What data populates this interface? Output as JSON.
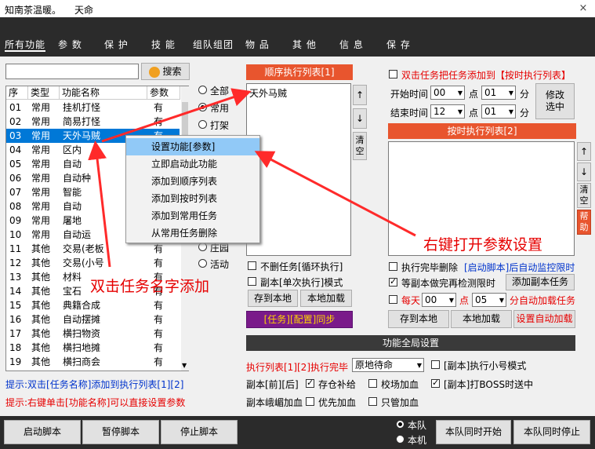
{
  "window": {
    "title": "知南茶温暖。",
    "subtitle": "天命",
    "close": "×"
  },
  "menu": [
    "所有功能",
    "参 数",
    "保 护",
    "技 能",
    "组队组团",
    "物 品",
    "其 他",
    "信 息",
    "保 存"
  ],
  "search": {
    "value": "",
    "button": "搜索"
  },
  "table": {
    "headers": [
      "序",
      "类型",
      "功能名称",
      "参数"
    ],
    "rows": [
      [
        "01",
        "常用",
        "挂机打怪",
        "有"
      ],
      [
        "02",
        "常用",
        "简易打怪",
        "有"
      ],
      [
        "03",
        "常用",
        "天外马贼",
        "有"
      ],
      [
        "04",
        "常用",
        "区内",
        "有"
      ],
      [
        "05",
        "常用",
        "自动",
        "有"
      ],
      [
        "06",
        "常用",
        "自动种",
        "有"
      ],
      [
        "07",
        "常用",
        "智能",
        "有"
      ],
      [
        "08",
        "常用",
        "自动",
        "有"
      ],
      [
        "09",
        "常用",
        "屠地",
        "有"
      ],
      [
        "10",
        "常用",
        "自动运",
        "有"
      ],
      [
        "11",
        "其他",
        "交易(老板",
        "有"
      ],
      [
        "12",
        "其他",
        "交易(小号",
        "有"
      ],
      [
        "13",
        "其他",
        "材料",
        "有"
      ],
      [
        "14",
        "其他",
        "宝石",
        "有"
      ],
      [
        "15",
        "其他",
        "典籍合成",
        "有"
      ],
      [
        "16",
        "其他",
        "自动摆摊",
        "有"
      ],
      [
        "17",
        "其他",
        "横扫物资",
        "有"
      ],
      [
        "18",
        "其他",
        "横扫地摊",
        "有"
      ],
      [
        "19",
        "其他",
        "横扫商会",
        "有"
      ]
    ]
  },
  "filters": [
    "全部",
    "常用",
    "打架",
    "庄园",
    "活动"
  ],
  "context_menu": [
    "设置功能[参数]",
    "立即启动此功能",
    "添加到顺序列表",
    "添加到按时列表",
    "添加到常用任务",
    "从常用任务删除"
  ],
  "seq_list": {
    "header": "顺序执行列表[1]",
    "items": [
      "天外马贼"
    ],
    "up": "↑",
    "down": "↓",
    "clear": "清空"
  },
  "seq_options": {
    "no_delete": "不删任务[循环执行]",
    "single_mode": "副本[单次执行]模式",
    "save": "存到本地",
    "load": "本地加载",
    "sync": "[任务][配置]同步"
  },
  "timed": {
    "dblclick_add": "双击任务把任务添加到【按时执行列表】",
    "start_label": "开始时间",
    "start_hour": "00",
    "start_min": "01",
    "end_label": "结束时间",
    "end_hour": "12",
    "end_min": "01",
    "point": "点",
    "minute": "分",
    "modify": "修改选中",
    "header": "按时执行列表[2]",
    "up": "↑",
    "down": "↓",
    "clear": "清空",
    "help": "帮助",
    "done_delete": "执行完毕删除",
    "monitor": "[启动脚本]后自动监控限时",
    "check_after": "等副本做完再检测限时",
    "add_instance": "添加副本任务",
    "daily": "每天",
    "daily_min": "00",
    "daily_point": "点",
    "daily_sec": "05",
    "auto_load": "分自动加载任务",
    "save": "存到本地",
    "load": "本地加载",
    "set_auto": "设置自动加载"
  },
  "global": {
    "header": "功能全局设置",
    "after_label": "执行列表[1][2]执行完毕",
    "after_value": "原地待命",
    "small_mode": "[副本]执行小号模式",
    "inst_before": "副本[前][后]",
    "warehouse": "存仓补给",
    "school_heal": "校场加血",
    "boss_heal": "[副本]打BOSS时送中",
    "inst_add": "副本峨嵋加血",
    "priority_heal": "优先加血",
    "only_heal": "只管加血"
  },
  "tips": {
    "tip1": "提示:双击[任务名称]添加到执行列表[1][2]",
    "tip2": "提示:右键单击[功能名称]可以直接设置参数"
  },
  "annotations": {
    "right": "右键打开参数设置",
    "left": "双击任务名字添加"
  },
  "bottom": {
    "start": "启动脚本",
    "pause": "暂停脚本",
    "stop": "停止脚本",
    "team": "本队",
    "machine": "本机",
    "sync_start": "本队同时开始",
    "sync_stop": "本队同时停止"
  }
}
